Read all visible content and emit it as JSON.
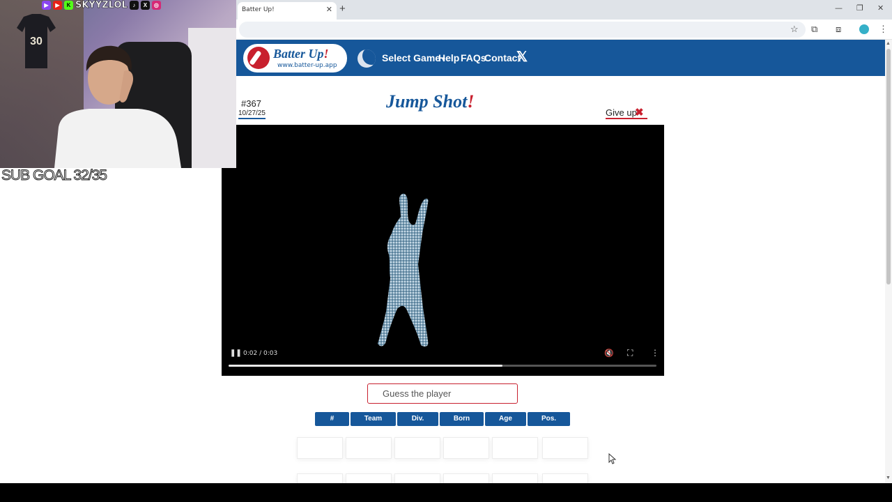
{
  "browser": {
    "tab_title": "Batter Up!",
    "tab_close": "✕",
    "new_tab": "+",
    "window_controls": {
      "minimize": "—",
      "restore": "❐",
      "close": "✕"
    },
    "toolbar_icons": {
      "bookmark": "☆",
      "extensions": "⧉",
      "cast": "⧈",
      "more": "⋮"
    }
  },
  "site": {
    "logo_title": "Batter Up",
    "logo_bang": "!",
    "logo_url": "www.batter-up.app",
    "nav": {
      "select_game": "Select Game",
      "select_caret": "▾",
      "help": "Help",
      "faqs": "FAQs",
      "contact": "Contact",
      "x_logo": "𝕏"
    }
  },
  "game": {
    "number": "#367",
    "date": "10/27/25",
    "title": "Jump Shot",
    "title_bang": "!",
    "give_up": "Give up",
    "give_up_icon": "✖"
  },
  "video": {
    "pause_icon": "❚❚",
    "time": "0:02 / 0:03",
    "mute_icon": "🔇",
    "fullscreen_icon": "⛶",
    "more_icon": "⋮",
    "progress_fraction": 0.64
  },
  "guess": {
    "placeholder": "Guess the player"
  },
  "columns": [
    "#",
    "Team",
    "Div.",
    "Born",
    "Age",
    "Pos."
  ],
  "stream": {
    "handle": "SKYYZLOL",
    "sub_goal": "SUB GOAL 32/35",
    "jersey_number": "30",
    "social_icons": [
      "twitch",
      "youtube",
      "kick",
      "tiktok",
      "x",
      "instagram"
    ]
  },
  "colors": {
    "brand_blue": "#16579a",
    "brand_red": "#c8202e"
  }
}
